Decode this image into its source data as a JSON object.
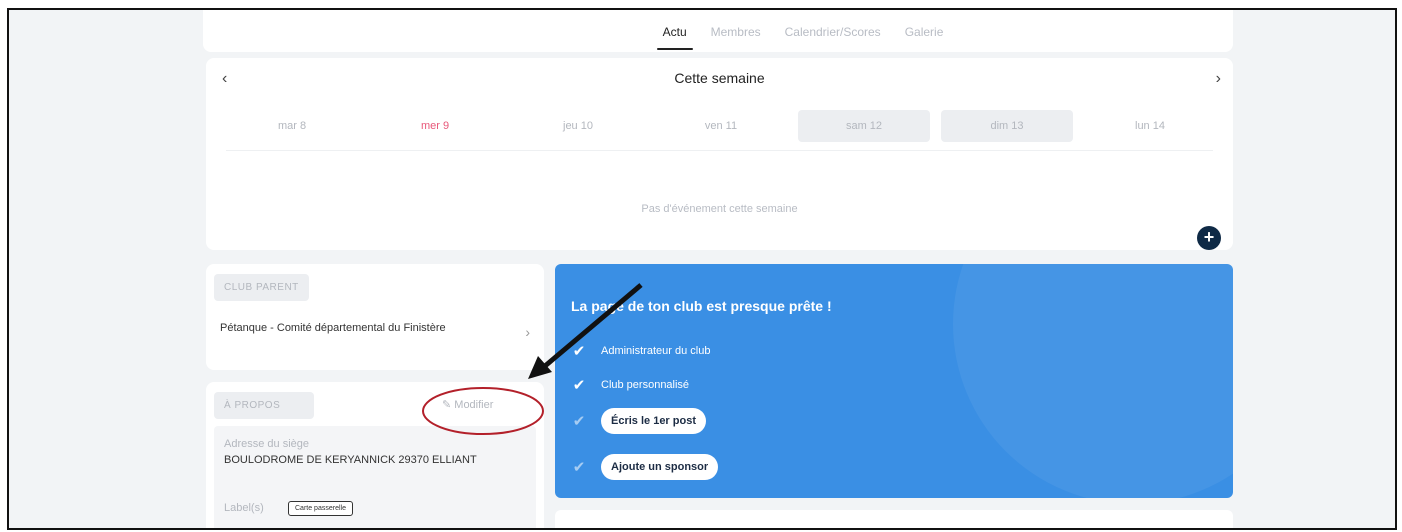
{
  "tabs": [
    {
      "label": "Actu",
      "active": true
    },
    {
      "label": "Membres",
      "active": false
    },
    {
      "label": "Calendrier/Scores",
      "active": false
    },
    {
      "label": "Galerie",
      "active": false
    }
  ],
  "week": {
    "title": "Cette semaine",
    "prev_icon": "chevron-left-icon",
    "next_icon": "chevron-right-icon",
    "days": [
      "mar 8",
      "mer 9",
      "jeu 10",
      "ven 11",
      "sam 12",
      "dim 13",
      "lun 14"
    ],
    "empty_message": "Pas d'événement cette semaine",
    "add_icon": "plus-icon"
  },
  "parent": {
    "heading": "CLUB PARENT",
    "name": "Pétanque - Comité départemental du Finistère"
  },
  "about": {
    "heading": "À PROPOS",
    "modify_label": "Modifier",
    "address_label": "Adresse du siège",
    "address_value": "BOULODROME DE KERYANNICK 29370 ELLIANT",
    "labels_label": "Label(s)",
    "labels_tag": "Carte passerelle"
  },
  "setup": {
    "title": "La page de ton club est presque prête !",
    "steps": [
      {
        "label": "Administrateur du club",
        "done": true,
        "button": false
      },
      {
        "label": "Club personnalisé",
        "done": true,
        "button": false
      },
      {
        "label": "Écris le 1er post",
        "done": false,
        "button": true
      },
      {
        "label": "Ajoute un sponsor",
        "done": false,
        "button": true
      }
    ]
  },
  "colors": {
    "accent_blue": "#3a8fe4",
    "today_pink": "#e8587a",
    "annotation_red": "#b3202a"
  }
}
